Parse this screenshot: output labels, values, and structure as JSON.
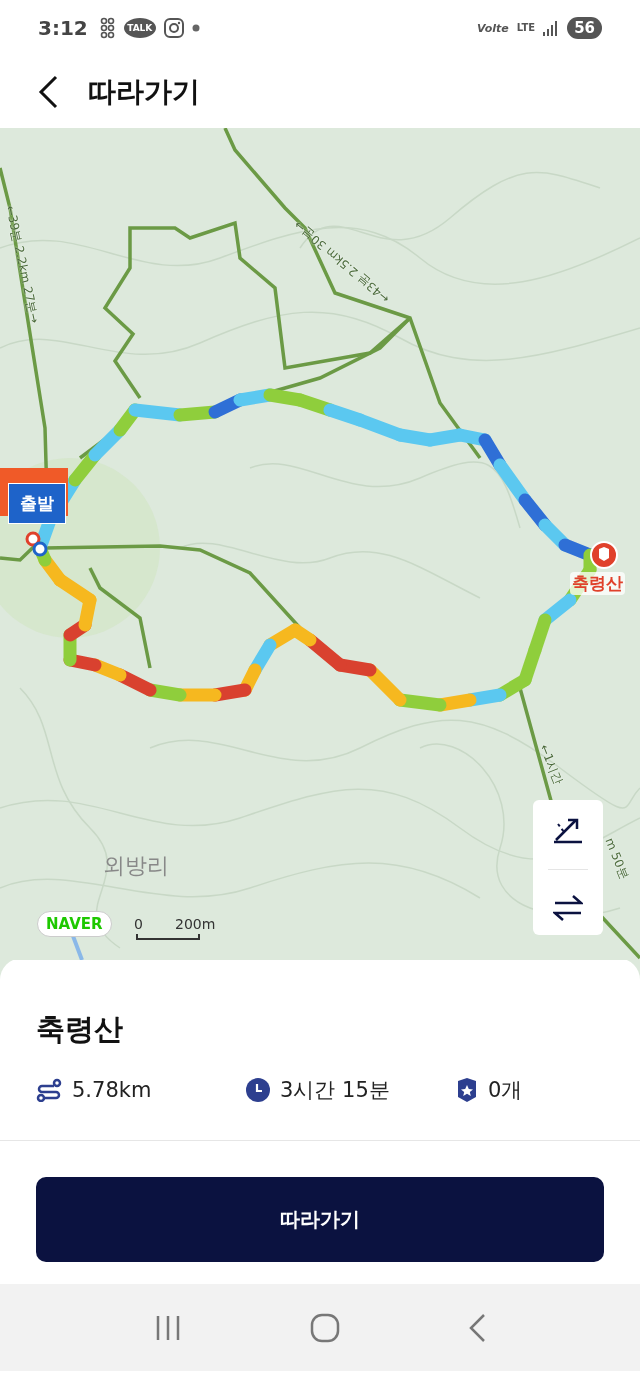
{
  "status_bar": {
    "time": "3:12",
    "talk_badge": "TALK",
    "volte": "Volte",
    "network": "LTE",
    "battery": "56"
  },
  "header": {
    "title": "따라가기"
  },
  "map": {
    "start_label": "출발",
    "summit_label": "축령산",
    "place_label": "외방리",
    "logo": "NAVER",
    "scale_zero": "0",
    "scale_distance": "200m",
    "trail_labels": [
      {
        "text": "←39분 2.2km 27분→",
        "kind": "a"
      },
      {
        "text": "←43분 2.5km 30분→",
        "kind": "b"
      },
      {
        "text": "←1시간",
        "kind": "c"
      },
      {
        "text": "m 50분",
        "kind": "d"
      }
    ]
  },
  "course": {
    "name": "축령산",
    "stats": [
      {
        "kind": "distance",
        "value": "5.78km"
      },
      {
        "kind": "time",
        "value": "3시간 15분"
      },
      {
        "kind": "summit",
        "value": "0개"
      }
    ]
  },
  "primary_button": "따라가기"
}
